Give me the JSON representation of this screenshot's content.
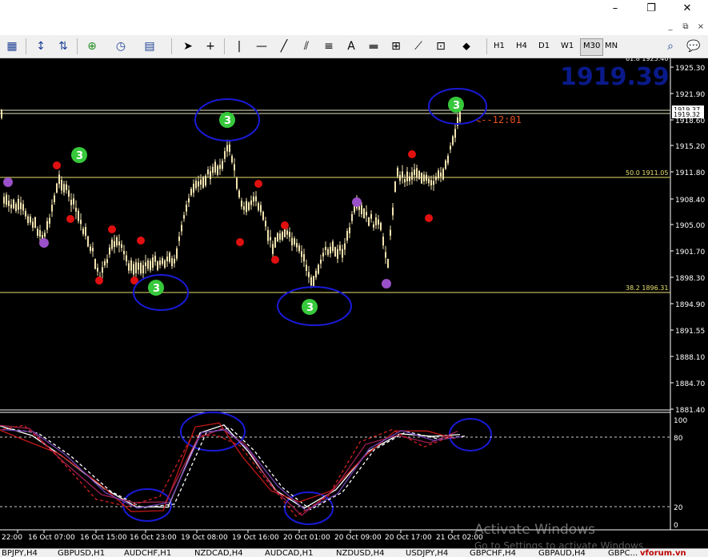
{
  "window": {
    "minimize": "–",
    "maximize": "❐",
    "close": "✕"
  },
  "mdi": {
    "minimize": "_",
    "restore": "⧉",
    "close": "×"
  },
  "toolbar": {
    "icons": [
      "layout-icon",
      "chart-add-icon",
      "chart-scroll-icon",
      "zoom-icon",
      "clock-icon",
      "template-icon",
      "cursor-icon",
      "crosshair-icon",
      "vline-icon",
      "hline-icon",
      "trendline-icon",
      "channel-icon",
      "fibonacci-icon",
      "text-icon",
      "rect-label-icon",
      "fibo-fan-icon",
      "arrows-icon",
      "search-icon",
      "chat-icon"
    ],
    "timeframes": [
      "H1",
      "H4",
      "D1",
      "W1",
      "M30",
      "MN"
    ],
    "active_timeframe": "M30"
  },
  "chart": {
    "big_price": "1919.39",
    "countdown": "<--12:01",
    "top_cut_label": "61.8 1925.40",
    "price_axis": [
      "1925.30",
      "1921.90",
      "1918.60",
      "1915.20",
      "1911.80",
      "1908.40",
      "1905.00",
      "1901.70",
      "1898.30",
      "1894.90",
      "1891.55",
      "1888.10",
      "1884.70",
      "1881.40"
    ],
    "bid_label": "1919.32",
    "ask_label": "1919.37",
    "fib_levels": [
      {
        "label": "50.0 1911.05"
      },
      {
        "label": "38.2 1896.31"
      }
    ],
    "osc_axis": [
      "100",
      "80",
      "20",
      "0"
    ],
    "time_axis": [
      "22:00",
      "16 Oct 07:00",
      "16 Oct 15:00",
      "16 Oct 23:00",
      "19 Oct 08:00",
      "19 Oct 16:00",
      "20 Oct 01:00",
      "20 Oct 09:00",
      "20 Oct 17:00",
      "21 Oct 02:00"
    ],
    "colors": {
      "up": "#f5e6b8",
      "down": "#f5e6b8",
      "fib": "#e8e070",
      "marker_green": "#37c83c",
      "marker_red": "#e01010",
      "marker_purple": "#9a50c8",
      "circle": "#1a1ad8"
    }
  },
  "tabs": [
    "BPJPY,H4",
    "GBPUSD,H1",
    "AUDCHF,H1",
    "NZDCAD,H4",
    "AUDCAD,H1",
    "NZDUSD,H4",
    "USDJPY,H4",
    "GBPCHF,H4",
    "GBPAUD,H4",
    "GBPC..."
  ],
  "watermark": {
    "line1": "Activate Windows",
    "line2": "Go to Settings to activate Windows."
  },
  "site_logo": "vforum.vn"
}
